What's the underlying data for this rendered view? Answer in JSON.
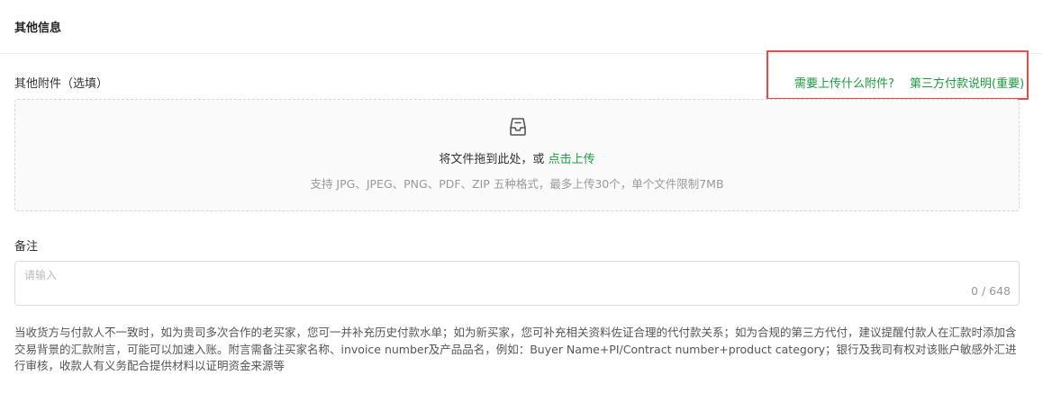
{
  "section": {
    "title": "其他信息"
  },
  "attachments": {
    "label": "其他附件（选填）",
    "help_links": [
      "需要上传什么附件?",
      "第三方付款说明(重要)"
    ],
    "dropzone": {
      "icon": "inbox-icon",
      "text_prefix": "将文件拖到此处，或 ",
      "text_link": "点击上传",
      "hint": "支持 JPG、JPEG、PNG、PDF、ZIP 五种格式，最多上传30个，单个文件限制7MB"
    }
  },
  "remark": {
    "label": "备注",
    "placeholder": "请输入",
    "value": "",
    "counter": "0 / 648"
  },
  "note": "当收货方与付款人不一致时，如为贵司多次合作的老买家，您可一并补充历史付款水单；如为新买家，您可补充相关资料佐证合理的代付款关系；如为合规的第三方代付，建议提醒付款人在汇款时添加含交易背景的汇款附言，可能可以加速入账。附言需备注买家名称、invoice number及产品品名，例如：Buyer Name+PI/Contract number+product category；银行及我司有权对该账户敏感外汇进行审核，收款人有义务配合提供材料以证明资金来源等",
  "colors": {
    "accent": "#1a9c3e",
    "highlight_border": "#e84a4a"
  }
}
